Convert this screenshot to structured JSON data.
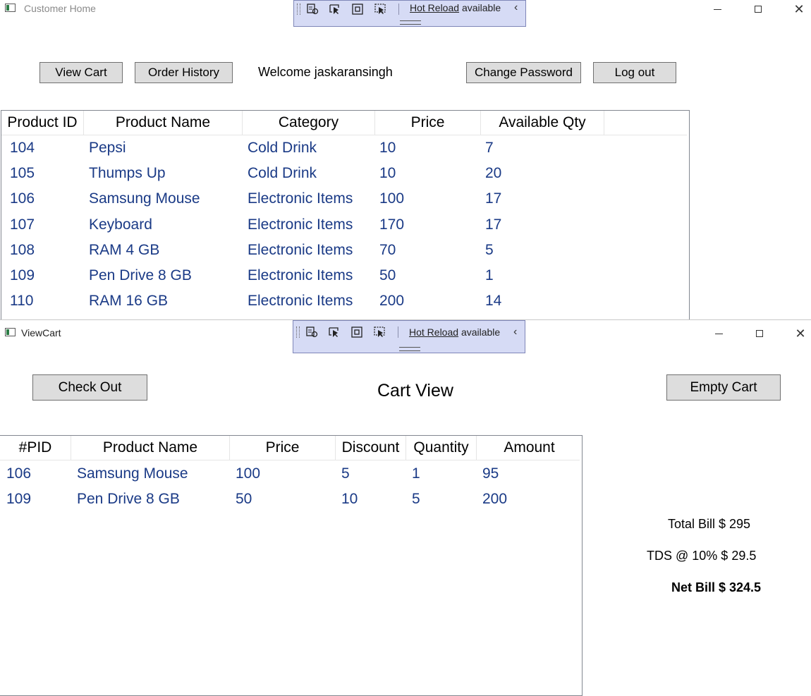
{
  "home": {
    "title": "Customer Home",
    "hot_reload": {
      "link": "Hot Reload",
      "text": "available"
    },
    "buttons": {
      "view_cart": "View Cart",
      "order_history": "Order History",
      "change_password": "Change Password",
      "log_out": "Log out"
    },
    "welcome": "Welcome jaskaransingh",
    "columns": [
      "Product ID",
      "Product Name",
      "Category",
      "Price",
      "Available Qty"
    ],
    "rows": [
      [
        "104",
        "Pepsi",
        "Cold Drink",
        "10",
        "7"
      ],
      [
        "105",
        "Thumps Up",
        "Cold Drink",
        "10",
        "20"
      ],
      [
        "106",
        "Samsung Mouse",
        "Electronic Items",
        "100",
        "17"
      ],
      [
        "107",
        "Keyboard",
        "Electronic Items",
        "170",
        "17"
      ],
      [
        "108",
        "RAM 4 GB",
        "Electronic Items",
        "70",
        "5"
      ],
      [
        "109",
        "Pen Drive 8 GB",
        "Electronic Items",
        "50",
        "1"
      ],
      [
        "110",
        "RAM 16 GB",
        "Electronic Items",
        "200",
        "14"
      ]
    ]
  },
  "cart": {
    "title": "ViewCart",
    "hot_reload": {
      "link": "Hot Reload",
      "text": "available"
    },
    "buttons": {
      "check_out": "Check Out",
      "empty_cart": "Empty Cart"
    },
    "heading": "Cart View",
    "columns": [
      "#PID",
      "Product Name",
      "Price",
      "Discount",
      "Quantity",
      "Amount"
    ],
    "rows": [
      [
        "106",
        "Samsung Mouse",
        "100",
        "5",
        "1",
        "95"
      ],
      [
        "109",
        "Pen Drive 8 GB",
        "50",
        "10",
        "5",
        "200"
      ]
    ],
    "total_bill": "Total Bill $ 295",
    "tds": "TDS @ 10% $ 29.5",
    "net_bill": "Net Bill $ 324.5"
  },
  "icons": {
    "app": "wpf-app-icon",
    "tools": [
      "visual-tree-icon",
      "select-element-icon",
      "display-layout-adorners-icon",
      "track-focus-icon"
    ],
    "chevron": "chevron-left-icon",
    "minimize": "minimize-icon",
    "maximize": "maximize-icon",
    "close": "close-icon"
  },
  "colors": {
    "cell_text": "#1a3a86",
    "button_bg": "#dddddd",
    "hot_reload_bg": "#d6dbf5"
  }
}
